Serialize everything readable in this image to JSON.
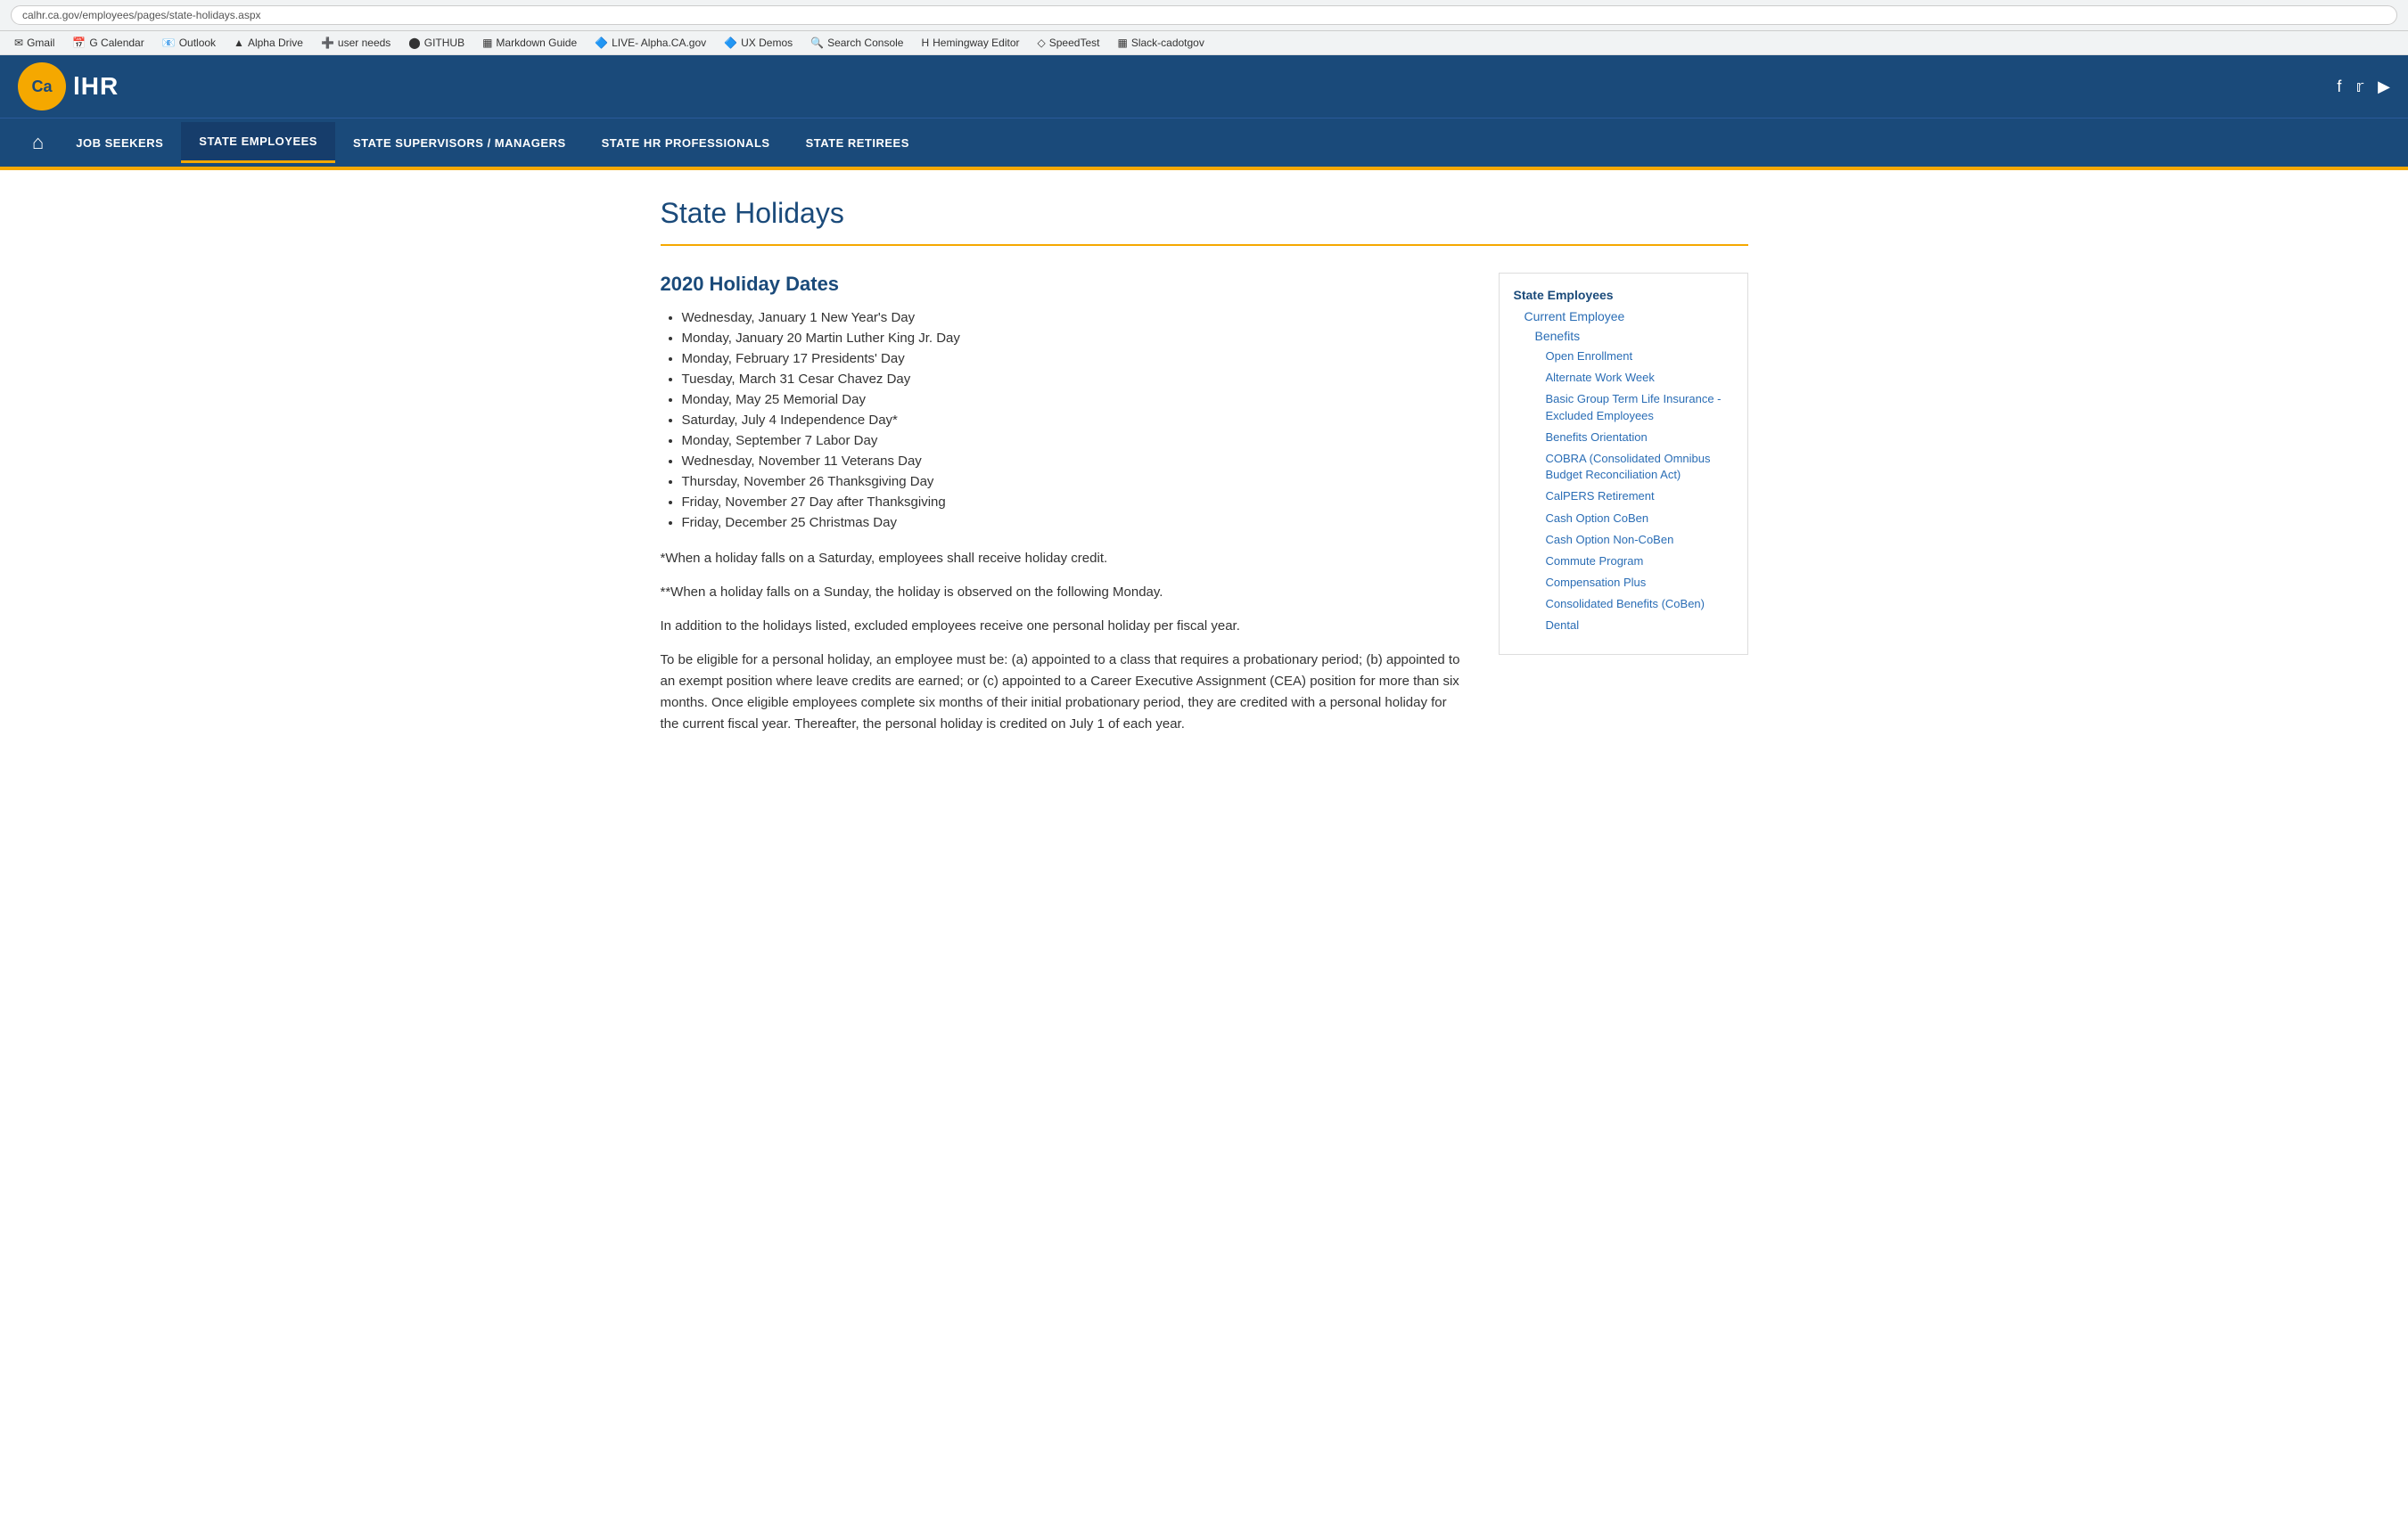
{
  "browser": {
    "url": "calhr.ca.gov/employees/pages/state-holidays.aspx"
  },
  "bookmarks": [
    {
      "label": "Gmail",
      "icon": "✉"
    },
    {
      "label": "G Calendar",
      "icon": "📅"
    },
    {
      "label": "Outlook",
      "icon": "📧"
    },
    {
      "label": "Alpha Drive",
      "icon": "▲"
    },
    {
      "label": "user needs",
      "icon": "➕"
    },
    {
      "label": "GITHUB",
      "icon": "⬤"
    },
    {
      "label": "Markdown Guide",
      "icon": "▦"
    },
    {
      "label": "LIVE- Alpha.CA.gov",
      "icon": "🔷"
    },
    {
      "label": "UX Demos",
      "icon": "🔷"
    },
    {
      "label": "Search Console",
      "icon": "🔍"
    },
    {
      "label": "Hemingway Editor",
      "icon": "H"
    },
    {
      "label": "SpeedTest",
      "icon": "◇"
    },
    {
      "label": "Slack-cadotgov",
      "icon": "▦"
    }
  ],
  "header": {
    "logo_text": "CalHR",
    "social": [
      "f",
      "🐦",
      "▶"
    ]
  },
  "nav": {
    "items": [
      {
        "label": "JOB SEEKERS",
        "active": false
      },
      {
        "label": "STATE EMPLOYEES",
        "active": true
      },
      {
        "label": "STATE SUPERVISORS / MANAGERS",
        "active": false
      },
      {
        "label": "STATE HR PROFESSIONALS",
        "active": false
      },
      {
        "label": "STATE RETIREES",
        "active": false
      }
    ]
  },
  "page": {
    "title": "State Holidays",
    "section_title": "2020 Holiday Dates",
    "holidays": [
      "Wednesday, January 1 New Year's Day",
      "Monday, January 20 Martin Luther King Jr. Day",
      "Monday, February 17 Presidents' Day",
      "Tuesday, March 31 Cesar Chavez Day",
      "Monday, May 25 Memorial Day",
      "Saturday, July 4 Independence Day*",
      "Monday, September 7 Labor Day",
      "Wednesday, November 11 Veterans Day",
      "Thursday, November 26 Thanksgiving Day",
      "Friday, November 27 Day after Thanksgiving",
      "Friday, December 25 Christmas Day"
    ],
    "notes": [
      "*When a holiday falls on a Saturday, employees shall receive holiday credit.",
      "**When a holiday falls on a Sunday, the holiday is observed on the following Monday.",
      "In addition to the holidays listed, excluded employees receive one personal holiday per fiscal year.",
      "To be eligible for a personal holiday, an employee must be: (a) appointed to a class that requires a probationary period; (b) appointed to an exempt position where leave credits are earned; or (c) appointed to a Career Executive Assignment (CEA) position for more than six months.  Once eligible employees complete six months of their initial probationary period, they are credited with a personal holiday for the current fiscal year.  Thereafter, the personal holiday is credited on July 1 of each year."
    ]
  },
  "sidebar": {
    "level0": "State Employees",
    "level1": "Current Employee",
    "level2": "Benefits",
    "items": [
      "Open Enrollment",
      "Alternate Work Week",
      "Basic Group Term Life Insurance - Excluded Employees",
      "Benefits Orientation",
      "COBRA (Consolidated Omnibus Budget Reconciliation Act)",
      "CalPERS Retirement",
      "Cash Option CoBen",
      "Cash Option Non-CoBen",
      "Commute Program",
      "Compensation Plus",
      "Consolidated Benefits (CoBen)",
      "Dental"
    ]
  }
}
